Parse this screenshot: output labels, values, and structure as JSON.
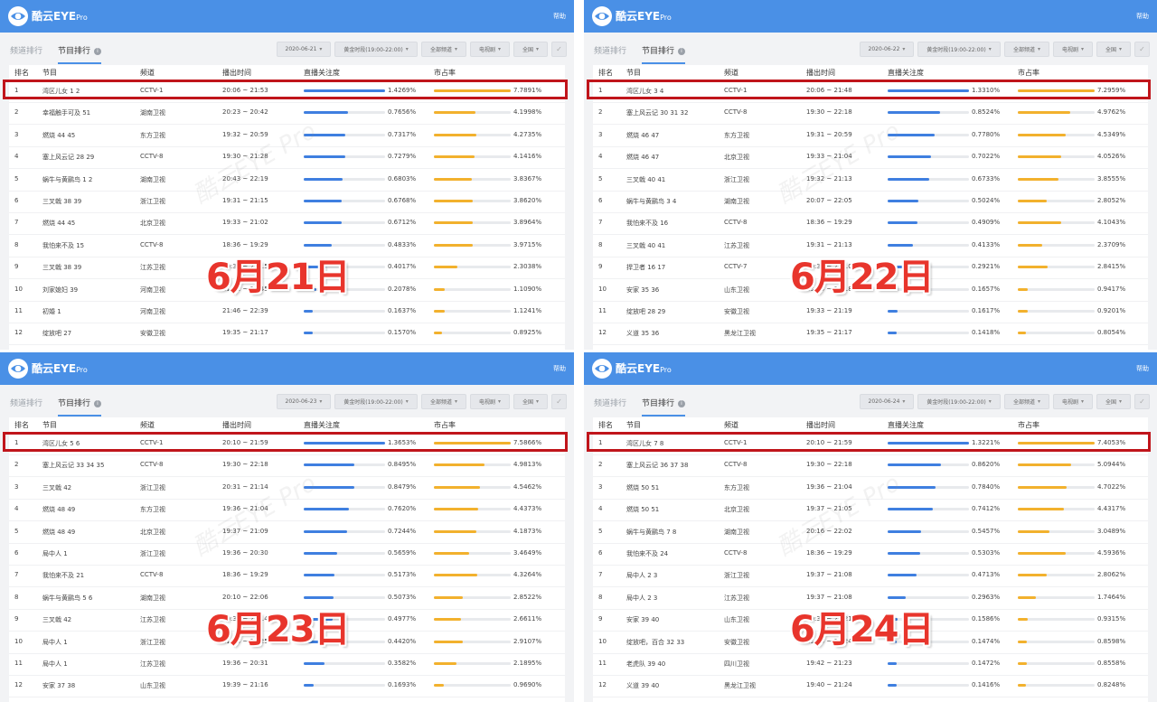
{
  "app": {
    "name": "酷云EYE",
    "name_suffix": "Pro",
    "help": "帮助"
  },
  "tabs": {
    "channel": "频道排行",
    "program": "节目排行"
  },
  "columns": {
    "rank": "排名",
    "program": "节目",
    "channel": "频道",
    "time": "播出时间",
    "attention": "直播关注度",
    "share": "市占率"
  },
  "filters_common": {
    "slot": "黄金时段(19:00-22:00)",
    "channels": "全部频道",
    "type": "电视剧",
    "region": "全国"
  },
  "colors": {
    "topbar": "#4a90e6",
    "attention_bar": "#3f7fe0",
    "share_bar": "#f2b12d",
    "highlight": "#c0151b",
    "date_label": "#e8352c"
  },
  "panels": [
    {
      "date": "2020-06-21",
      "overlay_label": "6月21日",
      "rows": [
        {
          "rank": "1",
          "name": "湾区儿女 1 2",
          "channel": "CCTV-1",
          "time": "20:06 ~ 21:53",
          "attention": "1.4269%",
          "share": "7.7891%",
          "att_fill": 1.0,
          "share_fill": 1.0
        },
        {
          "rank": "2",
          "name": "幸福触手可及 51",
          "channel": "湖南卫视",
          "time": "20:23 ~ 20:42",
          "attention": "0.7656%",
          "share": "4.1998%",
          "att_fill": 0.54,
          "share_fill": 0.54
        },
        {
          "rank": "3",
          "name": "燃烧 44 45",
          "channel": "东方卫视",
          "time": "19:32 ~ 20:59",
          "attention": "0.7317%",
          "share": "4.2735%",
          "att_fill": 0.51,
          "share_fill": 0.55
        },
        {
          "rank": "4",
          "name": "塞上风云记 28 29",
          "channel": "CCTV-8",
          "time": "19:30 ~ 21:28",
          "attention": "0.7279%",
          "share": "4.1416%",
          "att_fill": 0.51,
          "share_fill": 0.53
        },
        {
          "rank": "5",
          "name": "蜗牛与黄鹂鸟 1 2",
          "channel": "湖南卫视",
          "time": "20:43 ~ 22:19",
          "attention": "0.6803%",
          "share": "3.8367%",
          "att_fill": 0.48,
          "share_fill": 0.49
        },
        {
          "rank": "6",
          "name": "三叉戟 38 39",
          "channel": "浙江卫视",
          "time": "19:31 ~ 21:15",
          "attention": "0.6768%",
          "share": "3.8620%",
          "att_fill": 0.47,
          "share_fill": 0.5
        },
        {
          "rank": "7",
          "name": "燃烧 44 45",
          "channel": "北京卫视",
          "time": "19:33 ~ 21:02",
          "attention": "0.6712%",
          "share": "3.8964%",
          "att_fill": 0.47,
          "share_fill": 0.5
        },
        {
          "rank": "8",
          "name": "我怕来不及 15",
          "channel": "CCTV-8",
          "time": "18:36 ~ 19:29",
          "attention": "0.4833%",
          "share": "3.9715%",
          "att_fill": 0.34,
          "share_fill": 0.51
        },
        {
          "rank": "9",
          "name": "三叉戟 38 39",
          "channel": "江苏卫视",
          "time": "19:31 ~ 21:15",
          "attention": "0.4017%",
          "share": "2.3038%",
          "att_fill": 0.28,
          "share_fill": 0.3
        },
        {
          "rank": "10",
          "name": "刘家媳妇 39",
          "channel": "河南卫视",
          "time": "21:01 ~ 21:45",
          "attention": "0.2078%",
          "share": "1.1090%",
          "att_fill": 0.15,
          "share_fill": 0.14
        },
        {
          "rank": "11",
          "name": "初婚 1",
          "channel": "河南卫视",
          "time": "21:46 ~ 22:39",
          "attention": "0.1637%",
          "share": "1.1241%",
          "att_fill": 0.11,
          "share_fill": 0.14
        },
        {
          "rank": "12",
          "name": "绽放吧 27",
          "channel": "安徽卫视",
          "time": "19:35 ~ 21:17",
          "attention": "0.1570%",
          "share": "0.8925%",
          "att_fill": 0.11,
          "share_fill": 0.11
        }
      ]
    },
    {
      "date": "2020-06-22",
      "overlay_label": "6月22日",
      "rows": [
        {
          "rank": "1",
          "name": "湾区儿女 3 4",
          "channel": "CCTV-1",
          "time": "20:06 ~ 21:48",
          "attention": "1.3310%",
          "share": "7.2959%",
          "att_fill": 1.0,
          "share_fill": 1.0
        },
        {
          "rank": "2",
          "name": "塞上风云记 30 31 32",
          "channel": "CCTV-8",
          "time": "19:30 ~ 22:18",
          "attention": "0.8524%",
          "share": "4.9762%",
          "att_fill": 0.64,
          "share_fill": 0.68
        },
        {
          "rank": "3",
          "name": "燃烧 46 47",
          "channel": "东方卫视",
          "time": "19:31 ~ 20:59",
          "attention": "0.7780%",
          "share": "4.5349%",
          "att_fill": 0.58,
          "share_fill": 0.62
        },
        {
          "rank": "4",
          "name": "燃烧 46 47",
          "channel": "北京卫视",
          "time": "19:33 ~ 21:04",
          "attention": "0.7022%",
          "share": "4.0526%",
          "att_fill": 0.53,
          "share_fill": 0.56
        },
        {
          "rank": "5",
          "name": "三叉戟 40 41",
          "channel": "浙江卫视",
          "time": "19:32 ~ 21:13",
          "attention": "0.6733%",
          "share": "3.8555%",
          "att_fill": 0.51,
          "share_fill": 0.53
        },
        {
          "rank": "6",
          "name": "蜗牛与黄鹂鸟 3 4",
          "channel": "湖南卫视",
          "time": "20:07 ~ 22:05",
          "attention": "0.5024%",
          "share": "2.8052%",
          "att_fill": 0.38,
          "share_fill": 0.38
        },
        {
          "rank": "7",
          "name": "我怕来不及 16",
          "channel": "CCTV-8",
          "time": "18:36 ~ 19:29",
          "attention": "0.4909%",
          "share": "4.1043%",
          "att_fill": 0.37,
          "share_fill": 0.56
        },
        {
          "rank": "8",
          "name": "三叉戟 40 41",
          "channel": "江苏卫视",
          "time": "19:31 ~ 21:13",
          "attention": "0.4133%",
          "share": "2.3709%",
          "att_fill": 0.31,
          "share_fill": 0.32
        },
        {
          "rank": "9",
          "name": "捍卫者 16 17",
          "channel": "CCTV-7",
          "time": "19:30 ~ 21:10",
          "attention": "0.2921%",
          "share": "2.8415%",
          "att_fill": 0.22,
          "share_fill": 0.39
        },
        {
          "rank": "10",
          "name": "安家 35 36",
          "channel": "山东卫视",
          "time": "19:34 ~ 21:18",
          "attention": "0.1657%",
          "share": "0.9417%",
          "att_fill": 0.12,
          "share_fill": 0.13
        },
        {
          "rank": "11",
          "name": "绽放吧 28 29",
          "channel": "安徽卫视",
          "time": "19:33 ~ 21:19",
          "attention": "0.1617%",
          "share": "0.9201%",
          "att_fill": 0.12,
          "share_fill": 0.13
        },
        {
          "rank": "12",
          "name": "义道 35 36",
          "channel": "黑龙江卫视",
          "time": "19:35 ~ 21:17",
          "attention": "0.1418%",
          "share": "0.8054%",
          "att_fill": 0.11,
          "share_fill": 0.11
        }
      ]
    },
    {
      "date": "2020-06-23",
      "overlay_label": "6月23日",
      "rows": [
        {
          "rank": "1",
          "name": "湾区儿女 5 6",
          "channel": "CCTV-1",
          "time": "20:10 ~ 21:59",
          "attention": "1.3653%",
          "share": "7.5866%",
          "att_fill": 1.0,
          "share_fill": 1.0
        },
        {
          "rank": "2",
          "name": "塞上风云记 33 34 35",
          "channel": "CCTV-8",
          "time": "19:30 ~ 22:18",
          "attention": "0.8495%",
          "share": "4.9813%",
          "att_fill": 0.62,
          "share_fill": 0.66
        },
        {
          "rank": "3",
          "name": "三叉戟 42",
          "channel": "浙江卫视",
          "time": "20:31 ~ 21:14",
          "attention": "0.8479%",
          "share": "4.5462%",
          "att_fill": 0.62,
          "share_fill": 0.6
        },
        {
          "rank": "4",
          "name": "燃烧 48 49",
          "channel": "东方卫视",
          "time": "19:36 ~ 21:04",
          "attention": "0.7620%",
          "share": "4.4373%",
          "att_fill": 0.56,
          "share_fill": 0.58
        },
        {
          "rank": "5",
          "name": "燃烧 48 49",
          "channel": "北京卫视",
          "time": "19:37 ~ 21:09",
          "attention": "0.7244%",
          "share": "4.1873%",
          "att_fill": 0.53,
          "share_fill": 0.55
        },
        {
          "rank": "6",
          "name": "局中人 1",
          "channel": "浙江卫视",
          "time": "19:36 ~ 20:30",
          "attention": "0.5659%",
          "share": "3.4649%",
          "att_fill": 0.41,
          "share_fill": 0.46
        },
        {
          "rank": "7",
          "name": "我怕来不及 21",
          "channel": "CCTV-8",
          "time": "18:36 ~ 19:29",
          "attention": "0.5173%",
          "share": "4.3264%",
          "att_fill": 0.38,
          "share_fill": 0.57
        },
        {
          "rank": "8",
          "name": "蜗牛与黄鹂鸟 5 6",
          "channel": "湖南卫视",
          "time": "20:10 ~ 22:06",
          "attention": "0.5073%",
          "share": "2.8522%",
          "att_fill": 0.37,
          "share_fill": 0.38
        },
        {
          "rank": "9",
          "name": "三叉戟 42",
          "channel": "江苏卫视",
          "time": "20:31 ~ 21:14",
          "attention": "0.4977%",
          "share": "2.6611%",
          "att_fill": 0.36,
          "share_fill": 0.35
        },
        {
          "rank": "10",
          "name": "局中人 1",
          "channel": "浙江卫视",
          "time": "21:44 ~ 22:25",
          "attention": "0.4420%",
          "share": "2.9107%",
          "att_fill": 0.32,
          "share_fill": 0.38
        },
        {
          "rank": "11",
          "name": "局中人 1",
          "channel": "江苏卫视",
          "time": "19:36 ~ 20:31",
          "attention": "0.3582%",
          "share": "2.1895%",
          "att_fill": 0.26,
          "share_fill": 0.29
        },
        {
          "rank": "12",
          "name": "安家 37 38",
          "channel": "山东卫视",
          "time": "19:39 ~ 21:16",
          "attention": "0.1693%",
          "share": "0.9690%",
          "att_fill": 0.12,
          "share_fill": 0.13
        }
      ]
    },
    {
      "date": "2020-06-24",
      "overlay_label": "6月24日",
      "rows": [
        {
          "rank": "1",
          "name": "湾区儿女 7 8",
          "channel": "CCTV-1",
          "time": "20:10 ~ 21:59",
          "attention": "1.3221%",
          "share": "7.4053%",
          "att_fill": 1.0,
          "share_fill": 1.0
        },
        {
          "rank": "2",
          "name": "塞上风云记 36 37 38",
          "channel": "CCTV-8",
          "time": "19:30 ~ 22:18",
          "attention": "0.8620%",
          "share": "5.0944%",
          "att_fill": 0.65,
          "share_fill": 0.69
        },
        {
          "rank": "3",
          "name": "燃烧 50 51",
          "channel": "东方卫视",
          "time": "19:36 ~ 21:04",
          "attention": "0.7840%",
          "share": "4.7022%",
          "att_fill": 0.59,
          "share_fill": 0.63
        },
        {
          "rank": "4",
          "name": "燃烧 50 51",
          "channel": "北京卫视",
          "time": "19:37 ~ 21:05",
          "attention": "0.7412%",
          "share": "4.4317%",
          "att_fill": 0.56,
          "share_fill": 0.6
        },
        {
          "rank": "5",
          "name": "蜗牛与黄鹂鸟 7 8",
          "channel": "湖南卫视",
          "time": "20:16 ~ 22:02",
          "attention": "0.5457%",
          "share": "3.0489%",
          "att_fill": 0.41,
          "share_fill": 0.41
        },
        {
          "rank": "6",
          "name": "我怕来不及 24",
          "channel": "CCTV-8",
          "time": "18:36 ~ 19:29",
          "attention": "0.5303%",
          "share": "4.5936%",
          "att_fill": 0.4,
          "share_fill": 0.62
        },
        {
          "rank": "7",
          "name": "局中人 2 3",
          "channel": "浙江卫视",
          "time": "19:37 ~ 21:08",
          "attention": "0.4713%",
          "share": "2.8062%",
          "att_fill": 0.36,
          "share_fill": 0.38
        },
        {
          "rank": "8",
          "name": "局中人 2 3",
          "channel": "江苏卫视",
          "time": "19:37 ~ 21:08",
          "attention": "0.2963%",
          "share": "1.7464%",
          "att_fill": 0.22,
          "share_fill": 0.24
        },
        {
          "rank": "9",
          "name": "安家 39 40",
          "channel": "山东卫视",
          "time": "19:37 ~ 21:21",
          "attention": "0.1586%",
          "share": "0.9315%",
          "att_fill": 0.12,
          "share_fill": 0.13
        },
        {
          "rank": "10",
          "name": "绽放吧，百合 32 33",
          "channel": "安徽卫视",
          "time": "19:39 ~ 21:24",
          "attention": "0.1474%",
          "share": "0.8598%",
          "att_fill": 0.11,
          "share_fill": 0.12
        },
        {
          "rank": "11",
          "name": "老虎队 39 40",
          "channel": "四川卫视",
          "time": "19:42 ~ 21:23",
          "attention": "0.1472%",
          "share": "0.8558%",
          "att_fill": 0.11,
          "share_fill": 0.12
        },
        {
          "rank": "12",
          "name": "义道 39 40",
          "channel": "黑龙江卫视",
          "time": "19:40 ~ 21:24",
          "attention": "0.1416%",
          "share": "0.8248%",
          "att_fill": 0.11,
          "share_fill": 0.11
        }
      ]
    }
  ]
}
